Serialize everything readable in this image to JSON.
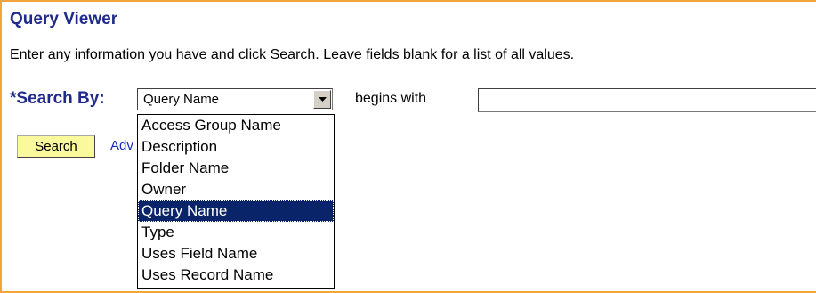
{
  "page": {
    "title": "Query Viewer",
    "instructions": "Enter any information you have and click Search. Leave fields blank for a list of all values."
  },
  "search_by": {
    "required_marker": "*",
    "label": "Search By:",
    "selected_value": "Query Name",
    "operator": "begins with",
    "input_value": "",
    "options": [
      "Access Group Name",
      "Description",
      "Folder Name",
      "Owner",
      "Query Name",
      "Type",
      "Uses Field Name",
      "Uses Record Name"
    ],
    "highlighted_option": "Query Name"
  },
  "actions": {
    "search_label": "Search",
    "advanced_link_visible": "Adv"
  },
  "colors": {
    "title": "#1f2a8c",
    "frame_border": "#f2a53a",
    "button_bg": "#fafa9c",
    "selection_bg": "#0a246a",
    "link": "#1a2bb8"
  },
  "icons": {
    "dropdown_arrow": "chevron-down-icon"
  }
}
